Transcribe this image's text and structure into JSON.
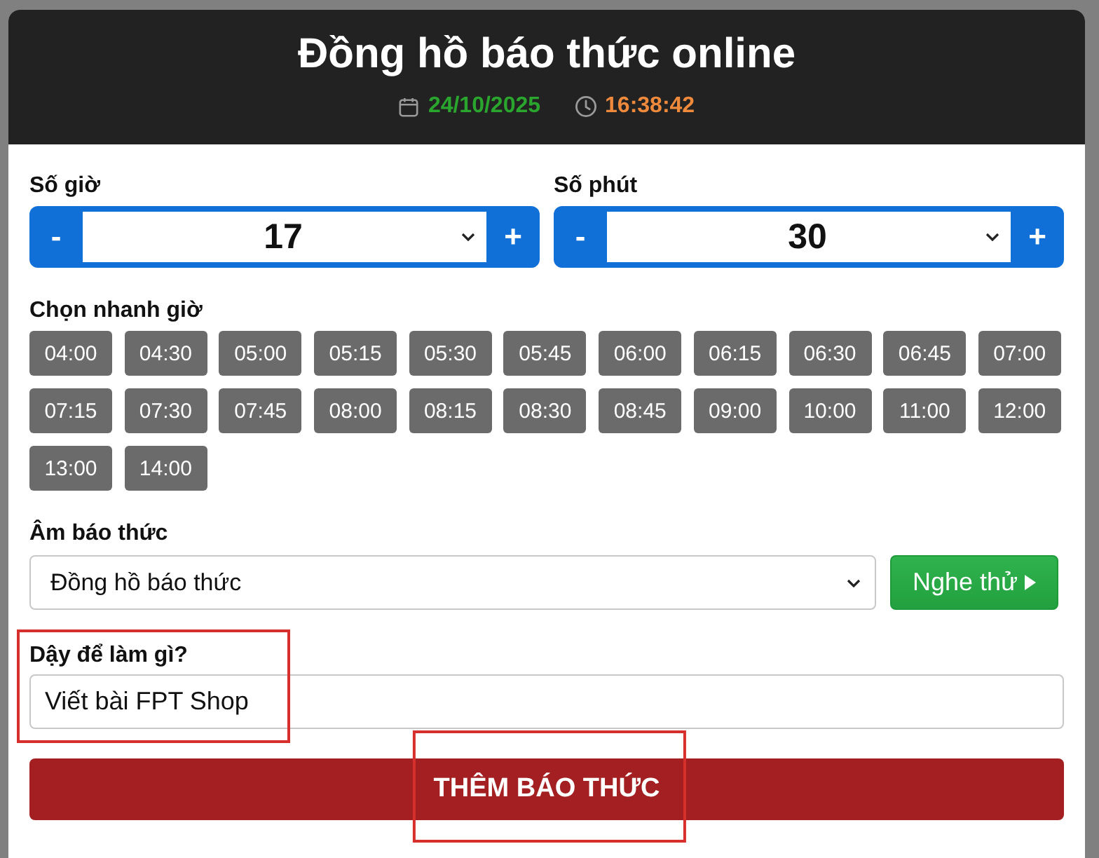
{
  "header": {
    "title": "Đồng hồ báo thức online",
    "date": "24/10/2025",
    "time": "16:38:42"
  },
  "time_pickers": [
    {
      "label": "Số giờ",
      "decrement": "-",
      "value": "17",
      "increment": "+"
    },
    {
      "label": "Số phút",
      "decrement": "-",
      "value": "30",
      "increment": "+"
    }
  ],
  "quick_times": {
    "label": "Chọn nhanh giờ",
    "items": [
      "04:00",
      "04:30",
      "05:00",
      "05:15",
      "05:30",
      "05:45",
      "06:00",
      "06:15",
      "06:30",
      "06:45",
      "07:00",
      "07:15",
      "07:30",
      "07:45",
      "08:00",
      "08:15",
      "08:30",
      "08:45",
      "09:00",
      "10:00",
      "11:00",
      "12:00",
      "13:00",
      "14:00"
    ]
  },
  "sound": {
    "label": "Âm báo thức",
    "value": "Đồng hồ báo thức",
    "preview_button": "Nghe thử"
  },
  "purpose": {
    "label": "Dậy để làm gì?",
    "value": "Viết bài FPT Shop",
    "highlighted": true
  },
  "add_button": {
    "label": "THÊM BÁO THỨC",
    "highlighted": true
  }
}
